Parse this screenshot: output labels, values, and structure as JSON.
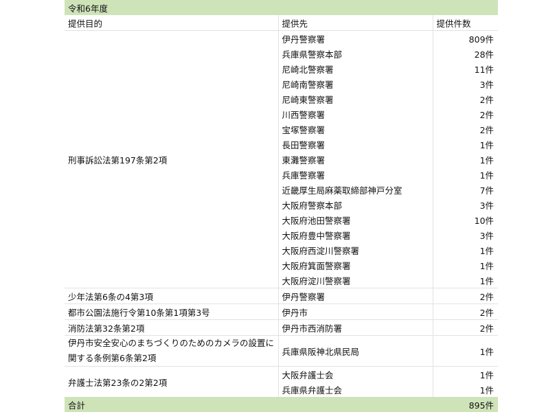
{
  "title": "令和6年度",
  "headers": {
    "purpose": "提供目的",
    "recipient": "提供先",
    "count": "提供件数"
  },
  "groups": [
    {
      "purpose": "刑事訴訟法第197条第2項",
      "rows": [
        {
          "recipient": "伊丹警察署",
          "count": "809件"
        },
        {
          "recipient": "兵庫県警察本部",
          "count": "28件"
        },
        {
          "recipient": "尼崎北警察署",
          "count": "11件"
        },
        {
          "recipient": "尼崎南警察署",
          "count": "3件"
        },
        {
          "recipient": "尼崎東警察署",
          "count": "2件"
        },
        {
          "recipient": "川西警察署",
          "count": "2件"
        },
        {
          "recipient": "宝塚警察署",
          "count": "2件"
        },
        {
          "recipient": "長田警察署",
          "count": "1件"
        },
        {
          "recipient": "東灘警察署",
          "count": "1件"
        },
        {
          "recipient": "兵庫警察署",
          "count": "1件"
        },
        {
          "recipient": "近畿厚生局麻薬取締部神戸分室",
          "count": "7件"
        },
        {
          "recipient": "大阪府警察本部",
          "count": "3件"
        },
        {
          "recipient": "大阪府池田警察署",
          "count": "10件"
        },
        {
          "recipient": "大阪府豊中警察署",
          "count": "3件"
        },
        {
          "recipient": "大阪府西淀川警察署",
          "count": "1件"
        },
        {
          "recipient": "大阪府箕面警察署",
          "count": "1件"
        },
        {
          "recipient": "大阪府淀川警察署",
          "count": "1件"
        }
      ]
    },
    {
      "purpose": "少年法第6条の4第3項",
      "rows": [
        {
          "recipient": "伊丹警察署",
          "count": "2件"
        }
      ]
    },
    {
      "purpose": "都市公園法施行令第10条第1項第3号",
      "rows": [
        {
          "recipient": "伊丹市",
          "count": "2件"
        }
      ]
    },
    {
      "purpose": "消防法第32条第2項",
      "rows": [
        {
          "recipient": "伊丹市西消防署",
          "count": "2件"
        }
      ]
    },
    {
      "purpose": "伊丹市安全安心のまちづくりのためのカメラの設置に関する条例第6条第2項",
      "tall": true,
      "rows": [
        {
          "recipient": "兵庫県阪神北県民局",
          "count": "1件"
        }
      ]
    },
    {
      "purpose": "弁護士法第23条の2第2項",
      "rows": [
        {
          "recipient": "大阪弁護士会",
          "count": "1件"
        },
        {
          "recipient": "兵庫県弁護士会",
          "count": "1件"
        }
      ]
    }
  ],
  "total": {
    "label": "合計",
    "count": "895件"
  }
}
